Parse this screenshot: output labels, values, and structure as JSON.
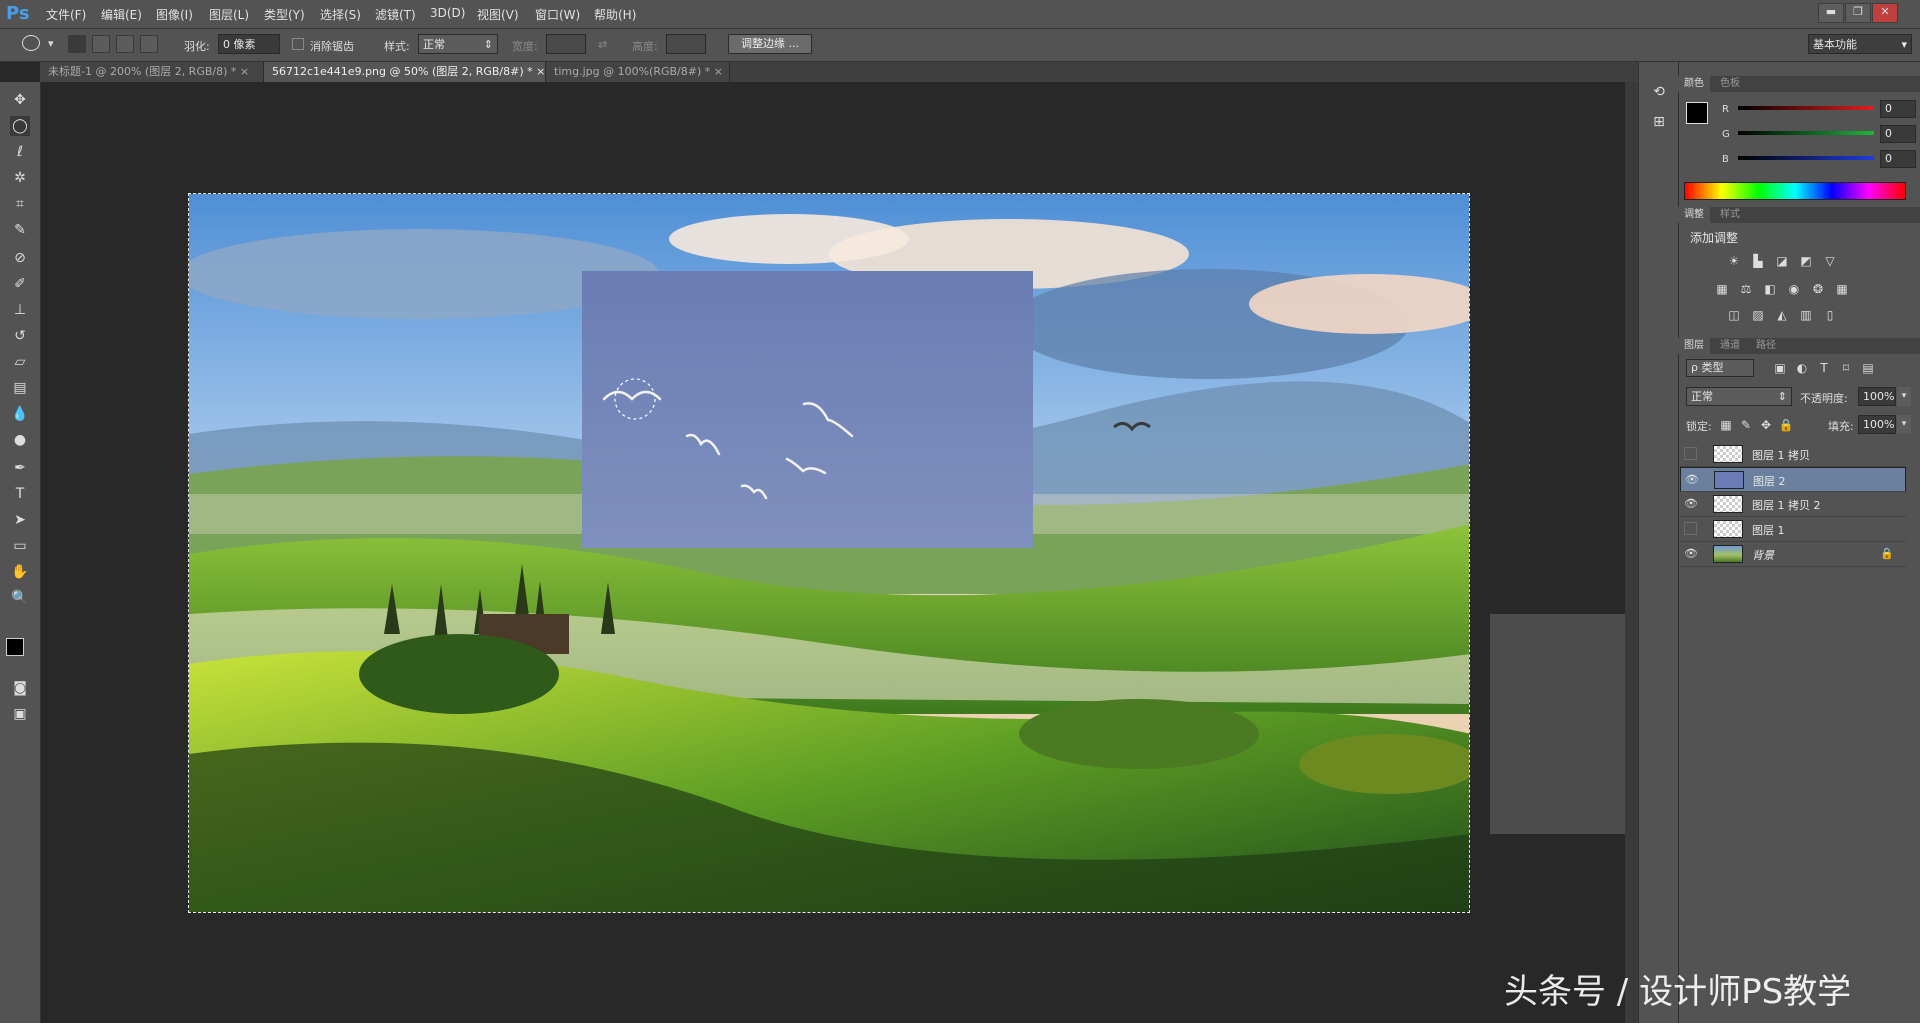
{
  "app": {
    "logo": "Ps"
  },
  "menu": [
    "文件(F)",
    "编辑(E)",
    "图像(I)",
    "图层(L)",
    "类型(Y)",
    "选择(S)",
    "滤镜(T)",
    "3D(D)",
    "视图(V)",
    "窗口(W)",
    "帮助(H)"
  ],
  "window_controls": {
    "minimize": "▬",
    "restore": "❐",
    "close": "✕"
  },
  "options": {
    "feather_label": "羽化:",
    "feather_value": "0 像素",
    "antialias_label": "消除锯齿",
    "style_label": "样式:",
    "style_value": "正常",
    "width_label": "宽度:",
    "height_label": "高度:",
    "refine_edge": "调整边缘 ...",
    "workspace": "基本功能"
  },
  "tabs": [
    {
      "label": "未标题-1 @ 200% (图层 2, RGB/8) *",
      "close": "×"
    },
    {
      "label": "56712c1e441e9.png @ 50% (图层 2, RGB/8#) *",
      "close": "×"
    },
    {
      "label": "timg.jpg @ 100%(RGB/8#) *",
      "close": "×"
    }
  ],
  "tools": [
    "move-icon",
    "elliptical-marquee-icon",
    "lasso-icon",
    "magic-wand-icon",
    "crop-icon",
    "eyedropper-icon",
    "healing-brush-icon",
    "brush-icon",
    "clone-stamp-icon",
    "history-brush-icon",
    "eraser-icon",
    "gradient-icon",
    "blur-icon",
    "dodge-icon",
    "pen-icon",
    "type-icon",
    "path-selection-icon",
    "rectangle-shape-icon",
    "hand-icon",
    "zoom-icon"
  ],
  "color_panel": {
    "tabs": [
      "颜色",
      "色板"
    ],
    "channels": [
      {
        "label": "R",
        "value": "0",
        "color": "#e01e1e"
      },
      {
        "label": "G",
        "value": "0",
        "color": "#1eb43c"
      },
      {
        "label": "B",
        "value": "0",
        "color": "#1e3ce0"
      }
    ]
  },
  "adjust_panel": {
    "tabs": [
      "调整",
      "样式"
    ],
    "title": "添加调整"
  },
  "layers_panel": {
    "tabs": [
      "图层",
      "通道",
      "路径"
    ],
    "filter_label": "ρ 类型",
    "blend_mode": "正常",
    "opacity_label": "不透明度:",
    "opacity_value": "100%",
    "lock_label": "锁定:",
    "fill_label": "填充:",
    "fill_value": "100%",
    "layers": [
      {
        "name": "图层 1 拷贝",
        "visible": false,
        "selected": false
      },
      {
        "name": "图层 2",
        "visible": true,
        "selected": true
      },
      {
        "name": "图层 1 拷贝 2",
        "visible": true,
        "selected": false
      },
      {
        "name": "图层 1",
        "visible": false,
        "selected": false
      },
      {
        "name": "背景",
        "visible": true,
        "selected": false,
        "locked": true
      }
    ]
  },
  "watermark": "头条号 / 设计师PS教学",
  "colors": {
    "accent": "#4a9ee8",
    "selected_layer": "#6b7f9f"
  }
}
